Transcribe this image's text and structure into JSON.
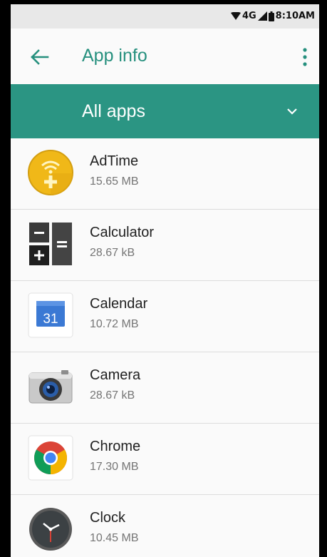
{
  "status_bar": {
    "network": "4G",
    "time": "8:10AM"
  },
  "app_bar": {
    "title": "App info",
    "back_icon": "arrow-back-icon",
    "menu_icon": "more-vert-icon"
  },
  "filter": {
    "selected": "All apps",
    "icon": "chevron-down-icon"
  },
  "apps": [
    {
      "name": "AdTime",
      "size": "15.65 MB",
      "icon": "adtime-icon"
    },
    {
      "name": "Calculator",
      "size": "28.67 kB",
      "icon": "calculator-icon"
    },
    {
      "name": "Calendar",
      "size": "10.72 MB",
      "icon": "calendar-icon",
      "icon_text": "31"
    },
    {
      "name": "Camera",
      "size": "28.67 kB",
      "icon": "camera-icon"
    },
    {
      "name": "Chrome",
      "size": "17.30 MB",
      "icon": "chrome-icon"
    },
    {
      "name": "Clock",
      "size": "10.45 MB",
      "icon": "clock-icon"
    }
  ],
  "colors": {
    "accent": "#2b9583",
    "title": "#26907e",
    "background": "#fafafa"
  }
}
